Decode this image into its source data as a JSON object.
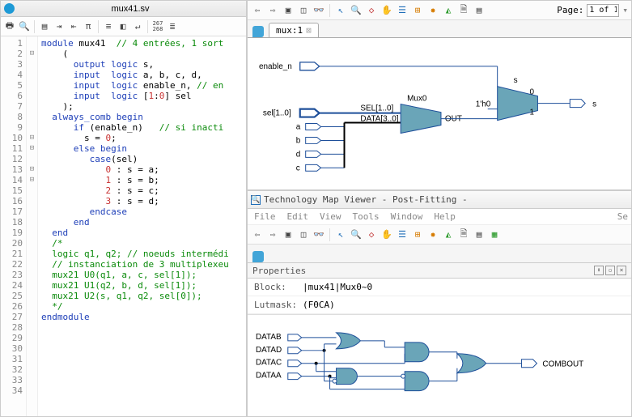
{
  "editor": {
    "filename": "mux41.sv",
    "lines": [
      "1",
      "2",
      "3",
      "4",
      "5",
      "6",
      "7",
      "8",
      "9",
      "10",
      "11",
      "12",
      "13",
      "14",
      "15",
      "16",
      "17",
      "18",
      "19",
      "20",
      "21",
      "22",
      "23",
      "24",
      "25",
      "26",
      "27",
      "28",
      "29",
      "30",
      "31",
      "32",
      "33",
      "34"
    ],
    "folds": [
      "",
      "⊟",
      "",
      "",
      "",
      "",
      "",
      "",
      "",
      "⊟",
      "⊟",
      "",
      "⊟",
      "⊟",
      "",
      "",
      "",
      "",
      "",
      "",
      "",
      "",
      "",
      "",
      "",
      "",
      "",
      "",
      "",
      "",
      "",
      "",
      "",
      ""
    ],
    "code_tokens": [
      [
        [
          "kw",
          "module"
        ],
        [
          "op",
          " mux41  "
        ],
        [
          "cm",
          "// 4 entrées, 1 sort"
        ]
      ],
      [
        [
          "op",
          "    ("
        ]
      ],
      [
        [
          "op",
          "      "
        ],
        [
          "kw",
          "output"
        ],
        [
          "op",
          " "
        ],
        [
          "ty",
          "logic"
        ],
        [
          "op",
          " s,"
        ]
      ],
      [
        [
          "op",
          "      "
        ],
        [
          "kw",
          "input"
        ],
        [
          "op",
          "  "
        ],
        [
          "ty",
          "logic"
        ],
        [
          "op",
          " a, b, c, d,"
        ]
      ],
      [
        [
          "op",
          "      "
        ],
        [
          "kw",
          "input"
        ],
        [
          "op",
          "  "
        ],
        [
          "ty",
          "logic"
        ],
        [
          "op",
          " enable_n, "
        ],
        [
          "cm",
          "// en"
        ]
      ],
      [
        [
          "op",
          "      "
        ],
        [
          "kw",
          "input"
        ],
        [
          "op",
          "  "
        ],
        [
          "ty",
          "logic"
        ],
        [
          "op",
          " ["
        ],
        [
          "num",
          "1"
        ],
        [
          "op",
          ":"
        ],
        [
          "num",
          "0"
        ],
        [
          "op",
          "] sel"
        ]
      ],
      [
        [
          "op",
          "    );"
        ]
      ],
      [
        [
          "op",
          ""
        ]
      ],
      [
        [
          "op",
          ""
        ]
      ],
      [
        [
          "op",
          "  "
        ],
        [
          "kw",
          "always_comb"
        ],
        [
          "op",
          " "
        ],
        [
          "kw",
          "begin"
        ]
      ],
      [
        [
          "op",
          "      "
        ],
        [
          "kw",
          "if"
        ],
        [
          "op",
          " (enable_n)   "
        ],
        [
          "cm",
          "// si inacti"
        ]
      ],
      [
        [
          "op",
          "        s = "
        ],
        [
          "num",
          "0"
        ],
        [
          "op",
          ";"
        ]
      ],
      [
        [
          "op",
          "      "
        ],
        [
          "kw",
          "else"
        ],
        [
          "op",
          " "
        ],
        [
          "kw",
          "begin"
        ]
      ],
      [
        [
          "op",
          "         "
        ],
        [
          "kw",
          "case"
        ],
        [
          "op",
          "(sel)"
        ]
      ],
      [
        [
          "op",
          "            "
        ],
        [
          "num",
          "0"
        ],
        [
          "op",
          " : s = a;"
        ]
      ],
      [
        [
          "op",
          "            "
        ],
        [
          "num",
          "1"
        ],
        [
          "op",
          " : s = b;"
        ]
      ],
      [
        [
          "op",
          "            "
        ],
        [
          "num",
          "2"
        ],
        [
          "op",
          " : s = c;"
        ]
      ],
      [
        [
          "op",
          "            "
        ],
        [
          "num",
          "3"
        ],
        [
          "op",
          " : s = d;"
        ]
      ],
      [
        [
          "op",
          "         "
        ],
        [
          "kw",
          "endcase"
        ]
      ],
      [
        [
          "op",
          "      "
        ],
        [
          "kw",
          "end"
        ]
      ],
      [
        [
          "op",
          "  "
        ],
        [
          "kw",
          "end"
        ]
      ],
      [
        [
          "op",
          ""
        ]
      ],
      [
        [
          "op",
          "  "
        ],
        [
          "cm",
          "/*"
        ]
      ],
      [
        [
          "op",
          "  "
        ],
        [
          "cm",
          "logic q1, q2; // noeuds intermédi"
        ]
      ],
      [
        [
          "op",
          ""
        ]
      ],
      [
        [
          "op",
          "  "
        ],
        [
          "cm",
          "// instanciation de 3 multiplexeu"
        ]
      ],
      [
        [
          "op",
          "  "
        ],
        [
          "cm",
          "mux21 U0(q1, a, c, sel[1]);"
        ]
      ],
      [
        [
          "op",
          "  "
        ],
        [
          "cm",
          "mux21 U1(q2, b, d, sel[1]);"
        ]
      ],
      [
        [
          "op",
          "  "
        ],
        [
          "cm",
          "mux21 U2(s, q1, q2, sel[0]);"
        ]
      ],
      [
        [
          "op",
          "  "
        ],
        [
          "cm",
          "*/"
        ]
      ],
      [
        [
          "op",
          ""
        ]
      ],
      [
        [
          "op",
          ""
        ]
      ],
      [
        [
          "kw",
          "endmodule"
        ]
      ],
      [
        [
          "op",
          ""
        ]
      ]
    ]
  },
  "topview": {
    "tab": "mux:1",
    "pagelabel": "Page:",
    "pageval": "1 of 1",
    "labels": {
      "enable_n": "enable_n",
      "sel": "sel[1..0]",
      "a": "a",
      "b": "b",
      "d": "d",
      "c": "c",
      "mux0": "Mux0",
      "selwire": "SEL[1..0]",
      "datawire": "DATA[3..0]",
      "out": "OUT",
      "s": "s",
      "const": "1'h0",
      "zero": "0",
      "one": "1",
      "sright": "s"
    }
  },
  "botview": {
    "title": "Technology Map Viewer - Post-Fitting -",
    "menu": [
      "File",
      "Edit",
      "View",
      "Tools",
      "Window",
      "Help"
    ],
    "search": "Se",
    "props": "Properties",
    "blocklbl": "Block:",
    "blockval": "|mux41|Mux0~0",
    "lutlbl": "Lutmask:",
    "lutval": "(F0CA)",
    "gates": {
      "datab": "DATAB",
      "datad": "DATAD",
      "datac": "DATAC",
      "dataa": "DATAA",
      "combout": "COMBOUT"
    }
  }
}
